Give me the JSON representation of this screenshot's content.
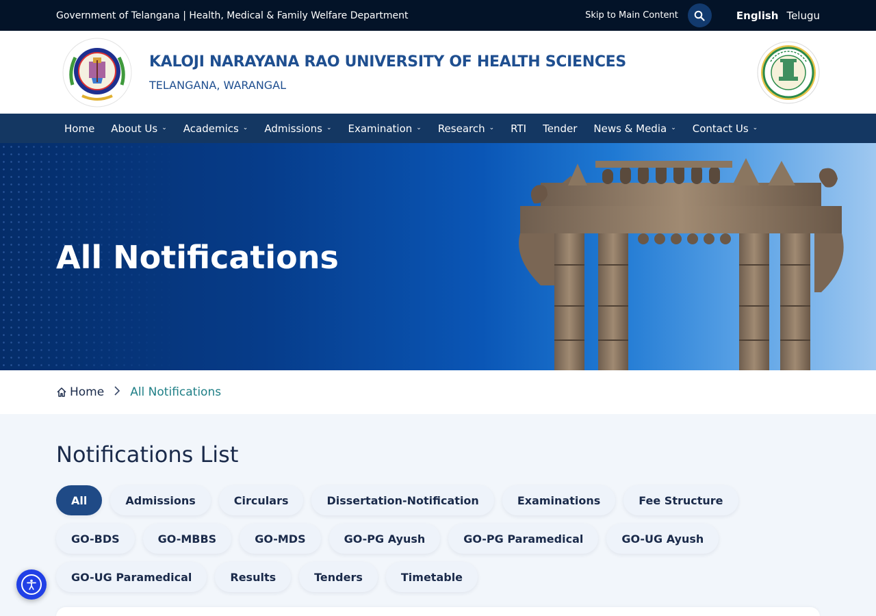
{
  "topbar": {
    "gov_text": "Government of Telangana | Health, Medical & Family Welfare Department",
    "skip_link": "Skip to Main Content",
    "search_icon": "search-icon",
    "languages": [
      {
        "label": "English",
        "active": true
      },
      {
        "label": "Telugu",
        "active": false
      }
    ]
  },
  "header": {
    "title": "KALOJI NARAYANA RAO UNIVERSITY OF HEALTH SCIENCES",
    "subtitle": "TELANGANA, WARANGAL",
    "university_logo": "university-emblem",
    "gov_logo": "government-of-telangana-emblem"
  },
  "nav": {
    "items": [
      {
        "label": "Home",
        "dropdown": false
      },
      {
        "label": "About Us",
        "dropdown": true
      },
      {
        "label": "Academics",
        "dropdown": true
      },
      {
        "label": "Admissions",
        "dropdown": true
      },
      {
        "label": "Examination",
        "dropdown": true
      },
      {
        "label": "Research",
        "dropdown": true
      },
      {
        "label": "RTI",
        "dropdown": false
      },
      {
        "label": "Tender",
        "dropdown": false
      },
      {
        "label": "News & Media",
        "dropdown": true
      },
      {
        "label": "Contact Us",
        "dropdown": true
      }
    ]
  },
  "hero": {
    "title": "All Notifications"
  },
  "breadcrumb": {
    "home_icon": "home-icon",
    "home": "Home",
    "separator_icon": "chevron-right-icon",
    "current": "All Notifications"
  },
  "main": {
    "heading": "Notifications List",
    "filters": [
      {
        "label": "All",
        "active": true
      },
      {
        "label": "Admissions",
        "active": false
      },
      {
        "label": "Circulars",
        "active": false
      },
      {
        "label": "Dissertation-Notification",
        "active": false
      },
      {
        "label": "Examinations",
        "active": false
      },
      {
        "label": "Fee Structure",
        "active": false
      },
      {
        "label": "GO-BDS",
        "active": false
      },
      {
        "label": "GO-MBBS",
        "active": false
      },
      {
        "label": "GO-MDS",
        "active": false
      },
      {
        "label": "GO-PG Ayush",
        "active": false
      },
      {
        "label": "GO-PG Paramedical",
        "active": false
      },
      {
        "label": "GO-UG Ayush",
        "active": false
      },
      {
        "label": "GO-UG Paramedical",
        "active": false
      },
      {
        "label": "Results",
        "active": false
      },
      {
        "label": "Tenders",
        "active": false
      },
      {
        "label": "Timetable",
        "active": false
      }
    ]
  },
  "accessibility": {
    "icon": "accessibility-icon"
  },
  "colors": {
    "topbar_bg": "#031328",
    "nav_bg": "#143762",
    "brand_blue": "#1f4f90",
    "active_chip": "#1f4a86",
    "breadcrumb_current": "#1f7f86",
    "a11y_button": "#2140e6"
  }
}
